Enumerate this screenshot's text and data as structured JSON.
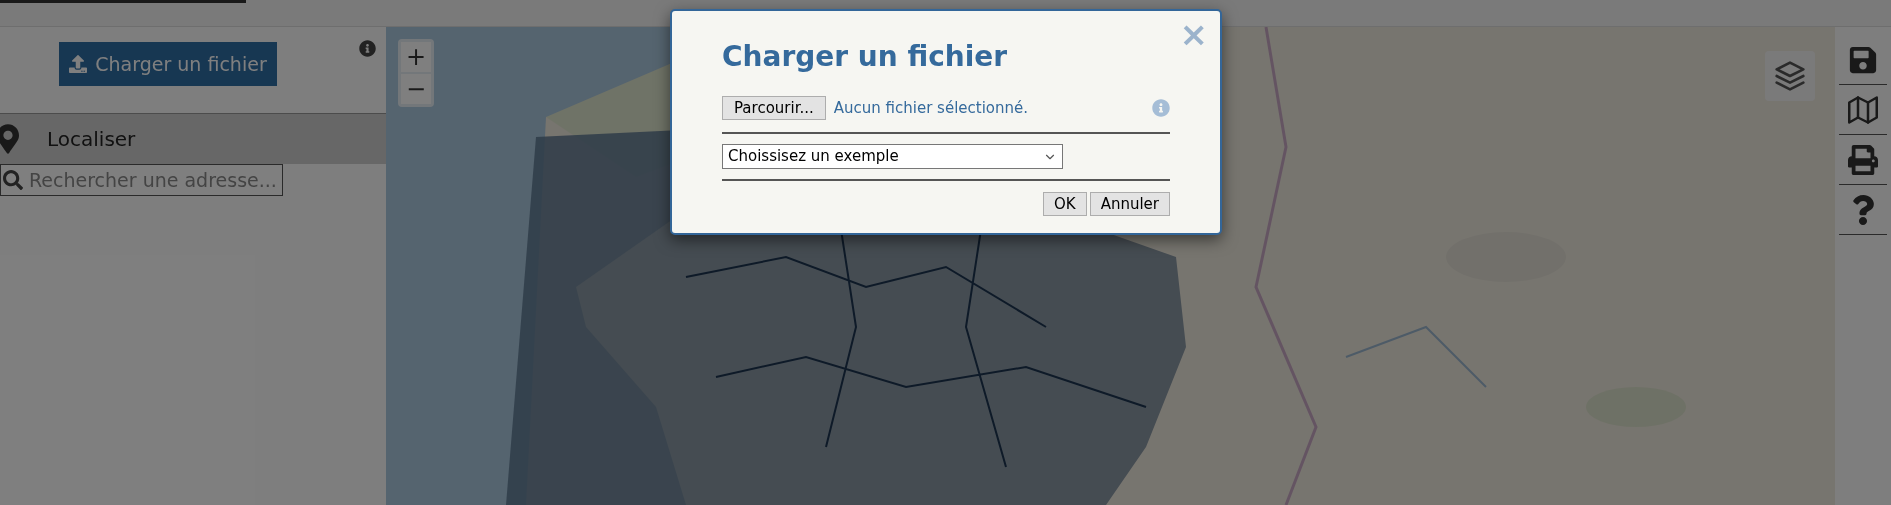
{
  "top_bar": {
    "progress": {
      "level": 0.13
    }
  },
  "sidebar": {
    "upload_button": "Charger un fichier",
    "locate_section": {
      "label": "Localiser",
      "expanded": true
    },
    "search": {
      "placeholder": "Rechercher une adresse..."
    }
  },
  "map": {
    "zoom_controls": [
      "+",
      "−"
    ]
  },
  "toolbar": {
    "items": [
      {
        "kind": "save"
      },
      {
        "kind": "map"
      },
      {
        "kind": "print"
      },
      {
        "kind": "help"
      }
    ]
  },
  "dialog": {
    "title": "Charger un fichier",
    "close": "×",
    "browse_button": "Parcourir...",
    "file_status": "Aucun fichier sélectionné.",
    "example_select": "Choissisez un exemple",
    "buttons": [
      "OK",
      "Annuler"
    ]
  }
}
